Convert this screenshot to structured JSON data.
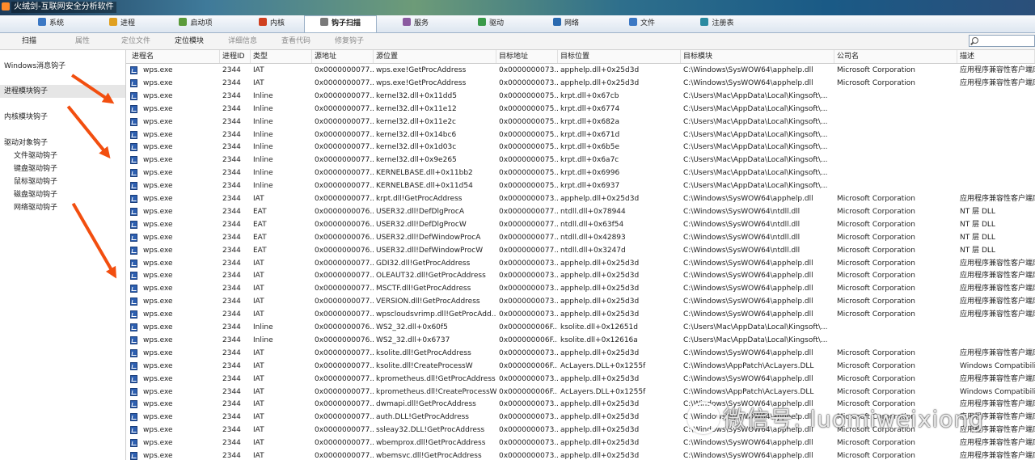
{
  "window": {
    "title": "火绒剑-互联网安全分析软件"
  },
  "tabs": [
    {
      "label": "系统",
      "color": "#3b78c4"
    },
    {
      "label": "进程",
      "color": "#e0a020"
    },
    {
      "label": "启动项",
      "color": "#5a9a3a"
    },
    {
      "label": "内核",
      "color": "#d04020"
    },
    {
      "label": "钩子扫描",
      "color": "#7a7a7a",
      "active": true
    },
    {
      "label": "服务",
      "color": "#8a5aa0"
    },
    {
      "label": "驱动",
      "color": "#3a9a4a"
    },
    {
      "label": "网络",
      "color": "#2a6ab0"
    },
    {
      "label": "文件",
      "color": "#3b78c4"
    },
    {
      "label": "注册表",
      "color": "#2a8aa0"
    }
  ],
  "toolbar": {
    "buttons": [
      {
        "label": "扫描",
        "enabled": true
      },
      {
        "label": "属性",
        "enabled": false
      },
      {
        "label": "定位文件",
        "enabled": false
      },
      {
        "label": "定位模块",
        "enabled": true
      },
      {
        "label": "详细信息",
        "enabled": false
      },
      {
        "label": "查看代码",
        "enabled": false
      },
      {
        "label": "修复钩子",
        "enabled": false
      }
    ],
    "search_value": ""
  },
  "sidebar": {
    "items": [
      {
        "label": "Windows消息钩子"
      },
      {
        "label": "进程模块钩子",
        "selected": true
      },
      {
        "label": "内核模块钩子"
      },
      {
        "label": "驱动对象钩子"
      },
      {
        "label": "文件驱动钩子"
      },
      {
        "label": "键盘驱动钩子"
      },
      {
        "label": "鼠标驱动钩子"
      },
      {
        "label": "磁盘驱动钩子"
      },
      {
        "label": "网络驱动钩子"
      }
    ]
  },
  "table": {
    "columns": [
      "进程名",
      "进程ID",
      "类型",
      "源地址",
      "源位置",
      "目标地址",
      "目标位置",
      "目标模块",
      "公司名",
      "描述"
    ],
    "rows": [
      [
        "wps.exe",
        "2344",
        "IAT",
        "0x0000000077...",
        "wps.exe!GetProcAddress",
        "0x0000000073...",
        "apphelp.dll+0x25d3d",
        "C:\\Windows\\SysWOW64\\apphelp.dll",
        "Microsoft Corporation",
        "应用程序兼容性客户端库"
      ],
      [
        "wps.exe",
        "2344",
        "IAT",
        "0x0000000077...",
        "wps.exe!GetProcAddress",
        "0x0000000073...",
        "apphelp.dll+0x25d3d",
        "C:\\Windows\\SysWOW64\\apphelp.dll",
        "Microsoft Corporation",
        "应用程序兼容性客户端库"
      ],
      [
        "wps.exe",
        "2344",
        "Inline",
        "0x0000000077...",
        "kernel32.dll+0x11dd5",
        "0x0000000075...",
        "krpt.dll+0x67cb",
        "C:\\Users\\Mac\\AppData\\Local\\Kingsoft\\...",
        "",
        ""
      ],
      [
        "wps.exe",
        "2344",
        "Inline",
        "0x0000000077...",
        "kernel32.dll+0x11e12",
        "0x0000000075...",
        "krpt.dll+0x6774",
        "C:\\Users\\Mac\\AppData\\Local\\Kingsoft\\...",
        "",
        ""
      ],
      [
        "wps.exe",
        "2344",
        "Inline",
        "0x0000000077...",
        "kernel32.dll+0x11e2c",
        "0x0000000075...",
        "krpt.dll+0x682a",
        "C:\\Users\\Mac\\AppData\\Local\\Kingsoft\\...",
        "",
        ""
      ],
      [
        "wps.exe",
        "2344",
        "Inline",
        "0x0000000077...",
        "kernel32.dll+0x14bc6",
        "0x0000000075...",
        "krpt.dll+0x671d",
        "C:\\Users\\Mac\\AppData\\Local\\Kingsoft\\...",
        "",
        ""
      ],
      [
        "wps.exe",
        "2344",
        "Inline",
        "0x0000000077...",
        "kernel32.dll+0x1d03c",
        "0x0000000075...",
        "krpt.dll+0x6b5e",
        "C:\\Users\\Mac\\AppData\\Local\\Kingsoft\\...",
        "",
        ""
      ],
      [
        "wps.exe",
        "2344",
        "Inline",
        "0x0000000077...",
        "kernel32.dll+0x9e265",
        "0x0000000075...",
        "krpt.dll+0x6a7c",
        "C:\\Users\\Mac\\AppData\\Local\\Kingsoft\\...",
        "",
        ""
      ],
      [
        "wps.exe",
        "2344",
        "Inline",
        "0x0000000077...",
        "KERNELBASE.dll+0x11bb2",
        "0x0000000075...",
        "krpt.dll+0x6996",
        "C:\\Users\\Mac\\AppData\\Local\\Kingsoft\\...",
        "",
        ""
      ],
      [
        "wps.exe",
        "2344",
        "Inline",
        "0x0000000077...",
        "KERNELBASE.dll+0x11d54",
        "0x0000000075...",
        "krpt.dll+0x6937",
        "C:\\Users\\Mac\\AppData\\Local\\Kingsoft\\...",
        "",
        ""
      ],
      [
        "wps.exe",
        "2344",
        "IAT",
        "0x0000000077...",
        "krpt.dll!GetProcAddress",
        "0x0000000073...",
        "apphelp.dll+0x25d3d",
        "C:\\Windows\\SysWOW64\\apphelp.dll",
        "Microsoft Corporation",
        "应用程序兼容性客户端库"
      ],
      [
        "wps.exe",
        "2344",
        "EAT",
        "0x0000000076...",
        "USER32.dll!DefDlgProcA",
        "0x0000000077...",
        "ntdll.dll+0x78944",
        "C:\\Windows\\SysWOW64\\ntdll.dll",
        "Microsoft Corporation",
        "NT 层 DLL"
      ],
      [
        "wps.exe",
        "2344",
        "EAT",
        "0x0000000076...",
        "USER32.dll!DefDlgProcW",
        "0x0000000077...",
        "ntdll.dll+0x63f54",
        "C:\\Windows\\SysWOW64\\ntdll.dll",
        "Microsoft Corporation",
        "NT 层 DLL"
      ],
      [
        "wps.exe",
        "2344",
        "EAT",
        "0x0000000076...",
        "USER32.dll!DefWindowProcA",
        "0x0000000077...",
        "ntdll.dll+0x42893",
        "C:\\Windows\\SysWOW64\\ntdll.dll",
        "Microsoft Corporation",
        "NT 层 DLL"
      ],
      [
        "wps.exe",
        "2344",
        "EAT",
        "0x0000000076...",
        "USER32.dll!DefWindowProcW",
        "0x0000000077...",
        "ntdll.dll+0x3247d",
        "C:\\Windows\\SysWOW64\\ntdll.dll",
        "Microsoft Corporation",
        "NT 层 DLL"
      ],
      [
        "wps.exe",
        "2344",
        "IAT",
        "0x0000000077...",
        "GDI32.dll!GetProcAddress",
        "0x0000000073...",
        "apphelp.dll+0x25d3d",
        "C:\\Windows\\SysWOW64\\apphelp.dll",
        "Microsoft Corporation",
        "应用程序兼容性客户端库"
      ],
      [
        "wps.exe",
        "2344",
        "IAT",
        "0x0000000077...",
        "OLEAUT32.dll!GetProcAddress",
        "0x0000000073...",
        "apphelp.dll+0x25d3d",
        "C:\\Windows\\SysWOW64\\apphelp.dll",
        "Microsoft Corporation",
        "应用程序兼容性客户端库"
      ],
      [
        "wps.exe",
        "2344",
        "IAT",
        "0x0000000077...",
        "MSCTF.dll!GetProcAddress",
        "0x0000000073...",
        "apphelp.dll+0x25d3d",
        "C:\\Windows\\SysWOW64\\apphelp.dll",
        "Microsoft Corporation",
        "应用程序兼容性客户端库"
      ],
      [
        "wps.exe",
        "2344",
        "IAT",
        "0x0000000077...",
        "VERSION.dll!GetProcAddress",
        "0x0000000073...",
        "apphelp.dll+0x25d3d",
        "C:\\Windows\\SysWOW64\\apphelp.dll",
        "Microsoft Corporation",
        "应用程序兼容性客户端库"
      ],
      [
        "wps.exe",
        "2344",
        "IAT",
        "0x0000000077...",
        "wpscloudsvrimp.dll!GetProcAdd...",
        "0x0000000073...",
        "apphelp.dll+0x25d3d",
        "C:\\Windows\\SysWOW64\\apphelp.dll",
        "Microsoft Corporation",
        "应用程序兼容性客户端库"
      ],
      [
        "wps.exe",
        "2344",
        "Inline",
        "0x0000000076...",
        "WS2_32.dll+0x60f5",
        "0x000000006F...",
        "ksolite.dll+0x12651d",
        "C:\\Users\\Mac\\AppData\\Local\\Kingsoft\\...",
        "",
        ""
      ],
      [
        "wps.exe",
        "2344",
        "Inline",
        "0x0000000076...",
        "WS2_32.dll+0x6737",
        "0x000000006F...",
        "ksolite.dll+0x12616a",
        "C:\\Users\\Mac\\AppData\\Local\\Kingsoft\\...",
        "",
        ""
      ],
      [
        "wps.exe",
        "2344",
        "IAT",
        "0x0000000077...",
        "ksolite.dll!GetProcAddress",
        "0x0000000073...",
        "apphelp.dll+0x25d3d",
        "C:\\Windows\\SysWOW64\\apphelp.dll",
        "Microsoft Corporation",
        "应用程序兼容性客户端库"
      ],
      [
        "wps.exe",
        "2344",
        "IAT",
        "0x0000000077...",
        "ksolite.dll!CreateProcessW",
        "0x000000006F...",
        "AcLayers.DLL+0x1255f",
        "C:\\Windows\\AppPatch\\AcLayers.DLL",
        "Microsoft Corporation",
        "Windows Compatibility"
      ],
      [
        "wps.exe",
        "2344",
        "IAT",
        "0x0000000077...",
        "kprometheus.dll!GetProcAddress",
        "0x0000000073...",
        "apphelp.dll+0x25d3d",
        "C:\\Windows\\SysWOW64\\apphelp.dll",
        "Microsoft Corporation",
        "应用程序兼容性客户端库"
      ],
      [
        "wps.exe",
        "2344",
        "IAT",
        "0x0000000077...",
        "kprometheus.dll!CreateProcessW",
        "0x000000006F...",
        "AcLayers.DLL+0x1255f",
        "C:\\Windows\\AppPatch\\AcLayers.DLL",
        "Microsoft Corporation",
        "Windows Compatibility"
      ],
      [
        "wps.exe",
        "2344",
        "IAT",
        "0x0000000077...",
        "dwmapi.dll!GetProcAddress",
        "0x0000000073...",
        "apphelp.dll+0x25d3d",
        "C:\\Windows\\SysWOW64\\apphelp.dll",
        "Microsoft Corporation",
        "应用程序兼容性客户端库"
      ],
      [
        "wps.exe",
        "2344",
        "IAT",
        "0x0000000077...",
        "auth.DLL!GetProcAddress",
        "0x0000000073...",
        "apphelp.dll+0x25d3d",
        "C:\\Windows\\SysWOW64\\apphelp.dll",
        "Microsoft Corporation",
        "应用程序兼容性客户端库"
      ],
      [
        "wps.exe",
        "2344",
        "IAT",
        "0x0000000077...",
        "ssleay32.DLL!GetProcAddress",
        "0x0000000073...",
        "apphelp.dll+0x25d3d",
        "C:\\Windows\\SysWOW64\\apphelp.dll",
        "Microsoft Corporation",
        "应用程序兼容性客户端库"
      ],
      [
        "wps.exe",
        "2344",
        "IAT",
        "0x0000000077...",
        "wbemprox.dll!GetProcAddress",
        "0x0000000073...",
        "apphelp.dll+0x25d3d",
        "C:\\Windows\\SysWOW64\\apphelp.dll",
        "Microsoft Corporation",
        "应用程序兼容性客户端库"
      ],
      [
        "wps.exe",
        "2344",
        "IAT",
        "0x0000000077...",
        "wbemsvc.dll!GetProcAddress",
        "0x0000000073...",
        "apphelp.dll+0x25d3d",
        "C:\\Windows\\SysWOW64\\apphelp.dll",
        "Microsoft Corporation",
        "应用程序兼容性客户端库"
      ]
    ]
  },
  "watermark": {
    "text": "微信号: luomiweixiong"
  },
  "annotation_color": "#f24e0f"
}
